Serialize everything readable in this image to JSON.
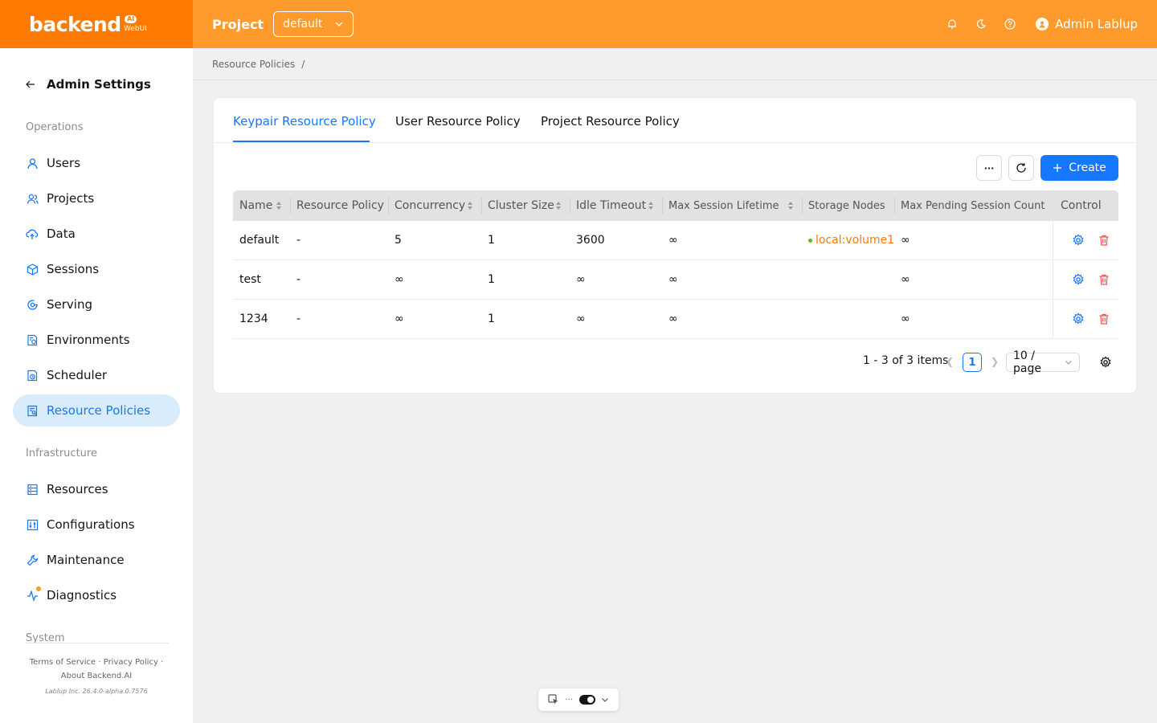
{
  "header": {
    "logo": "backend",
    "logo_badge": "AI",
    "logo_sub": "WebUI",
    "project_label": "Project",
    "project_value": "default",
    "user_name": "Admin Lablup"
  },
  "sidebar": {
    "title": "Admin Settings",
    "groups": {
      "operations": "Operations",
      "infrastructure": "Infrastructure",
      "system": "System"
    },
    "items": [
      {
        "label": "Users",
        "icon": "user-icon"
      },
      {
        "label": "Projects",
        "icon": "project-icon"
      },
      {
        "label": "Data",
        "icon": "cloud-upload-icon"
      },
      {
        "label": "Sessions",
        "icon": "cube-icon"
      },
      {
        "label": "Serving",
        "icon": "serving-icon"
      },
      {
        "label": "Environments",
        "icon": "environment-icon"
      },
      {
        "label": "Scheduler",
        "icon": "scheduler-icon"
      },
      {
        "label": "Resource Policies",
        "icon": "resource-policy-icon",
        "active": true
      },
      {
        "label": "Resources",
        "icon": "resources-icon"
      },
      {
        "label": "Configurations",
        "icon": "configurations-icon"
      },
      {
        "label": "Maintenance",
        "icon": "wrench-icon"
      },
      {
        "label": "Diagnostics",
        "icon": "pulse-icon"
      }
    ],
    "footer": {
      "terms": "Terms of Service",
      "privacy": "Privacy Policy",
      "about": "About Backend.AI",
      "version": "Lablup Inc. 26.4.0-alpha.0.7576"
    }
  },
  "breadcrumb": {
    "item": "Resource Policies",
    "sep": "/"
  },
  "tabs": [
    "Keypair Resource Policy",
    "User Resource Policy",
    "Project Resource Policy"
  ],
  "toolbar": {
    "more": "···",
    "create": "Create"
  },
  "table": {
    "columns": [
      "Name",
      "Resource Policy",
      "Concurrency",
      "Cluster Size",
      "Idle Timeout",
      "Max Session Lifetime",
      "Storage Nodes",
      "Max Pending Session Count",
      "Control"
    ],
    "rows": [
      {
        "name": "default",
        "policy": "-",
        "concurrency": "5",
        "cluster": "1",
        "idle": "3600",
        "lifetime": "∞",
        "storage": "local:volume1",
        "pending": "∞"
      },
      {
        "name": "test",
        "policy": "-",
        "concurrency": "∞",
        "cluster": "1",
        "idle": "∞",
        "lifetime": "∞",
        "storage": "",
        "pending": "∞"
      },
      {
        "name": "1234",
        "policy": "-",
        "concurrency": "∞",
        "cluster": "1",
        "idle": "∞",
        "lifetime": "∞",
        "storage": "",
        "pending": "∞"
      }
    ]
  },
  "pagination": {
    "summary": "1 - 3 of 3 items",
    "page": "1",
    "page_size": "10 / page"
  },
  "colors": {
    "brand": "#ff9a2c",
    "brand_dark": "#ff7a00",
    "primary": "#1677ff",
    "danger": "#ff4d4f"
  }
}
